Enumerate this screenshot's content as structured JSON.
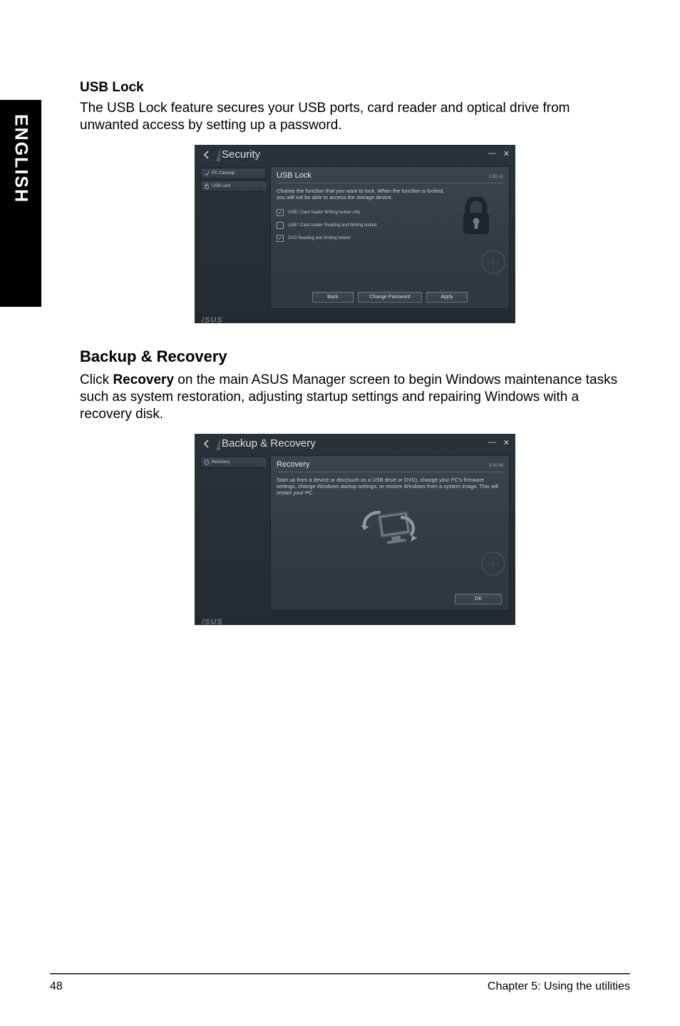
{
  "lang_tab": "ENGLISH",
  "section1": {
    "heading": "USB Lock",
    "body": "The USB Lock feature secures your USB ports, card reader and optical drive from unwanted access by setting up a password."
  },
  "section2": {
    "heading": "Backup & Recovery",
    "body_pre": "Click ",
    "body_bold": "Recovery",
    "body_post": " on the main ASUS Manager screen to begin Windows maintenance tasks such as system restoration, adjusting startup settings and repairing Windows with a recovery disk."
  },
  "shot1": {
    "window_title": "Security",
    "sidebar": [
      {
        "label": "PC Cleanup"
      },
      {
        "label": "USB Lock"
      }
    ],
    "panel_title": "USB Lock",
    "version": "2.00.12",
    "desc": "Choose the function that you want to lock. When the function is locked, you will not be able to access the storage device.",
    "options": [
      {
        "label": "USB \\ Card reader Writing locked only",
        "checked": true
      },
      {
        "label": "USB \\ Card reader Reading and Writing locked",
        "checked": false
      },
      {
        "label": "DVD Reading and Writing locked",
        "checked": true
      }
    ],
    "buttons": {
      "back": "Back",
      "change": "Change Password",
      "apply": "Apply"
    },
    "brand": "/SUS"
  },
  "shot2": {
    "window_title": "Backup & Recovery",
    "sidebar": [
      {
        "label": "Recovery"
      }
    ],
    "panel_title": "Recovery",
    "version": "2.00.08",
    "desc": "Start up from a device or disc(such as a USB drive or DVD), change your PC's firmware settings, change Windows startup settings, or restore Windows from a system image. This will restart your PC.",
    "buttons": {
      "ok": "OK"
    },
    "brand": "/SUS"
  },
  "footer": {
    "page_no": "48",
    "chapter": "Chapter 5: Using the utilities"
  }
}
